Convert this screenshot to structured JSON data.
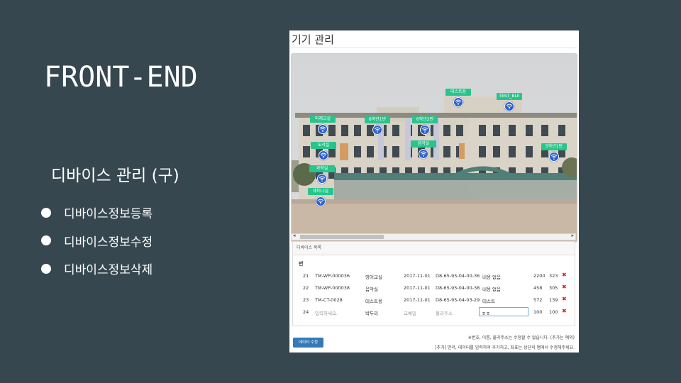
{
  "slide": {
    "title": "FRONT-END",
    "section": "디바이스 관리 (구)",
    "bullets": [
      "디바이스정보등록",
      "디바이스정보수정",
      "디바이스정보삭제"
    ]
  },
  "panel": {
    "title": "기기 관리",
    "map_labels": [
      "테스트용",
      "TEST_BLE",
      "미래교실",
      "6학년1반",
      "6학년2반",
      "도서실",
      "음악실",
      "5학년1반",
      "과학실",
      "세미나실"
    ],
    "list_title": "디바이스 목록",
    "column_header": "번",
    "rows": [
      {
        "no": "21",
        "id": "TM-WP-000036",
        "name": "영어교실",
        "date": "2017-11-01",
        "mac": "D8-65-95-04-00-36",
        "memo": "내용 없음",
        "x": "2200",
        "y": "323"
      },
      {
        "no": "22",
        "id": "TM-WP-000038",
        "name": "음악실",
        "date": "2017-11-01",
        "mac": "D8-65-95-04-00-38",
        "memo": "내용 없음",
        "x": "458",
        "y": "305"
      },
      {
        "no": "23",
        "id": "TM-CT-0028",
        "name": "테스트용",
        "date": "2017-11-01",
        "mac": "D8-65-95-04-03-29",
        "memo": "테스트",
        "x": "572",
        "y": "139"
      }
    ],
    "new_row": {
      "no": "24",
      "id_placeholder": "입력하세요.",
      "name": "박두리",
      "date_placeholder": "교체일",
      "mac_placeholder": "물리주소",
      "memo_value": "ㅎㅎ",
      "x": "100",
      "y": "100"
    },
    "delete_symbol": "✖",
    "notice1": "※번호, 이름, 물리주소는 수정할 수 없습니다. (추가는 예외)",
    "notice2": "[추가] 먼저, 데이터를 입력하여 추가하고, 좌표는 상단의 맵에서 수정해주세요.",
    "save_button": "데이터 수정"
  },
  "colors": {
    "background": "#37474f",
    "label_green": "#27c48b",
    "wifi_blue": "#2a5fd1",
    "button_blue": "#337ab7",
    "delete_red": "#c0302f"
  }
}
